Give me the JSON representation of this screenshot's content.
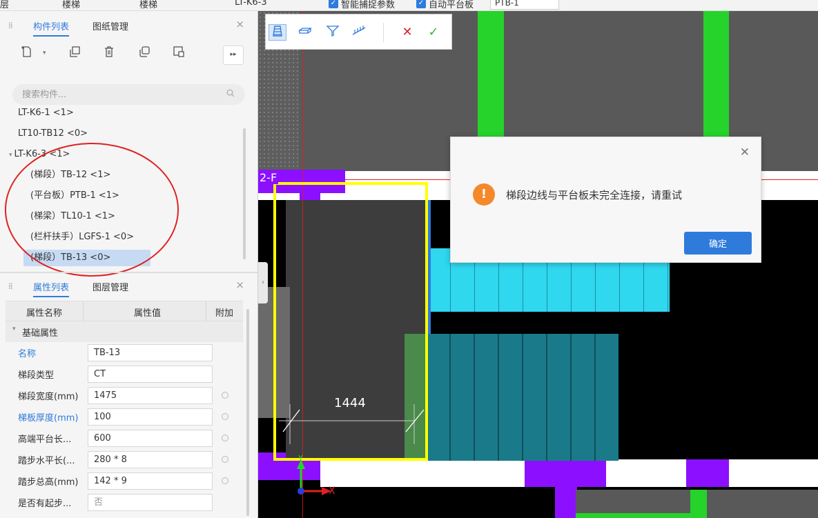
{
  "top_strip": {
    "item1": "层",
    "item2": "楼梯",
    "item3": "楼梯",
    "item4": "LT-K6-3",
    "checkbox1_label": "智能捕捉参数",
    "checkbox2_label": "自动平台板",
    "dropdown_value": "PTB-1"
  },
  "component_panel": {
    "tabs": [
      "构件列表",
      "图纸管理"
    ],
    "search_placeholder": "搜索构件...",
    "tree": [
      {
        "label": "LT-K6-1 <1>",
        "expanded": false
      },
      {
        "label": "LT10-TB12 <0>",
        "expanded": false
      },
      {
        "label": "LT-K6-3 <1>",
        "expanded": true
      },
      {
        "label": "(梯段）TB-12 <1>",
        "child": true
      },
      {
        "label": "(平台板）PTB-1 <1>",
        "child": true
      },
      {
        "label": "(梯梁）TL10-1 <1>",
        "child": true
      },
      {
        "label": "(栏杆扶手）LGFS-1 <0>",
        "child": true
      },
      {
        "label": "(梯段）TB-13 <0>",
        "child": true,
        "selected": true
      }
    ]
  },
  "property_panel": {
    "tabs": [
      "属性列表",
      "图层管理"
    ],
    "headers": [
      "属性名称",
      "属性值",
      "附加"
    ],
    "group": "基础属性",
    "rows": [
      {
        "name": "名称",
        "value": "TB-13",
        "blue": true
      },
      {
        "name": "梯段类型",
        "value": "CT"
      },
      {
        "name": "梯段宽度(mm)",
        "value": "1475"
      },
      {
        "name": "梯板厚度(mm)",
        "value": "100",
        "blue": true
      },
      {
        "name": "高端平台长...",
        "value": "600"
      },
      {
        "name": "踏步水平长(...",
        "value": "280 * 8"
      },
      {
        "name": "踏步总高(mm)",
        "value": "142 * 9"
      },
      {
        "name": "是否有起步...",
        "value": "否",
        "grey": true
      }
    ]
  },
  "canvas": {
    "axis_label": "2-F",
    "dimension": "1444",
    "axis_x": "X",
    "axis_y": "Y"
  },
  "dialog": {
    "message": "梯段边线与平台板未完全连接，请重试",
    "ok_label": "确定"
  },
  "colors": {
    "accent": "#2f7bdc",
    "warning": "#f5892a",
    "green_wall": "#25d32a",
    "purple_wall": "#8c10ff",
    "cyan_steps": "#2fd7ef",
    "teal_steps": "#1a7a8a",
    "highlight_yellow": "#ffff00",
    "annotation_red": "#e02020"
  }
}
